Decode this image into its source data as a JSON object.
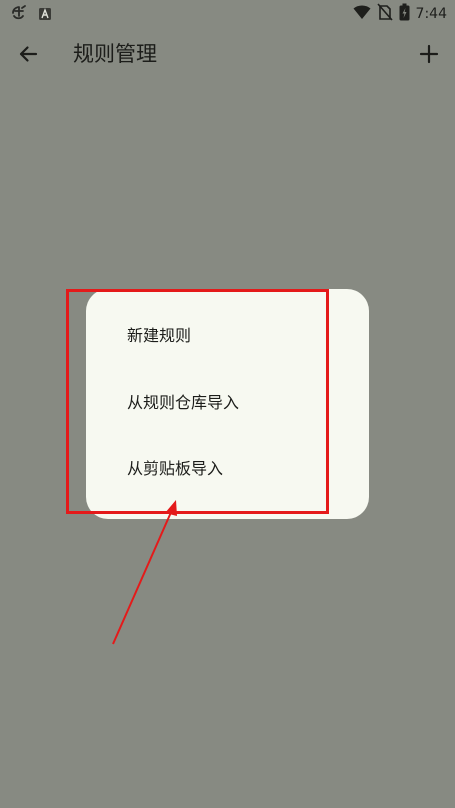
{
  "status_bar": {
    "time": "7:44",
    "icons": [
      "app-notification-icon",
      "a-badge-icon",
      "wifi-icon",
      "no-sim-icon",
      "battery-icon"
    ]
  },
  "app_bar": {
    "title": "规则管理",
    "back_icon": "arrow-left-icon",
    "add_icon": "plus-icon"
  },
  "menu": {
    "items": [
      {
        "label": "新建规则"
      },
      {
        "label": "从规则仓库导入"
      },
      {
        "label": "从剪贴板导入"
      }
    ]
  },
  "colors": {
    "scrim_background": "#878a82",
    "menu_background": "#f7f9f1",
    "text": "#1c1d1a",
    "annotation": "#e41a1a"
  }
}
